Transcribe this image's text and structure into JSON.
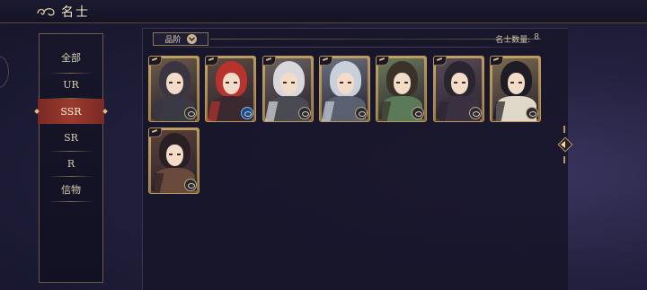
{
  "header": {
    "title": "名士",
    "icon": "swirl-cloud-icon"
  },
  "sidebar": {
    "items": [
      {
        "label": "全部",
        "active": false
      },
      {
        "label": "UR",
        "active": false
      },
      {
        "label": "SSR",
        "active": true
      },
      {
        "label": "SR",
        "active": false
      },
      {
        "label": "R",
        "active": false
      },
      {
        "label": "信物",
        "active": false
      }
    ]
  },
  "filter": {
    "label": "品阶",
    "icon": "chevron-down-icon"
  },
  "count": {
    "label": "名士数量:",
    "value": "8"
  },
  "cards": [
    {
      "hair": "#3a3540",
      "outfit": "#3a3a44",
      "bg": "#6a5a48",
      "badge": "gray"
    },
    {
      "hair": "#b8322e",
      "outfit": "#3a2a30",
      "bg": "#5a4a40",
      "badge": "blue"
    },
    {
      "hair": "#d8d8dc",
      "outfit": "#4a4a52",
      "bg": "#6a6260",
      "badge": "gray"
    },
    {
      "hair": "#c8d0dc",
      "outfit": "#5a6070",
      "bg": "#6a7080",
      "badge": "gray"
    },
    {
      "hair": "#3a3228",
      "outfit": "#5a7a58",
      "bg": "#6a7a5a",
      "badge": "gray"
    },
    {
      "hair": "#2a2630",
      "outfit": "#3a3040",
      "bg": "#5a4a58",
      "badge": "gray"
    },
    {
      "hair": "#1e1c24",
      "outfit": "#e0d8c8",
      "bg": "#7a6a50",
      "badge": "gray"
    },
    {
      "hair": "#2a2024",
      "outfit": "#6a4a3a",
      "bg": "#5a4038",
      "badge": "gray"
    }
  ],
  "colors": {
    "accent_red": "#9a3a2e",
    "gold": "#b8985e",
    "panel": "#1a1830"
  }
}
